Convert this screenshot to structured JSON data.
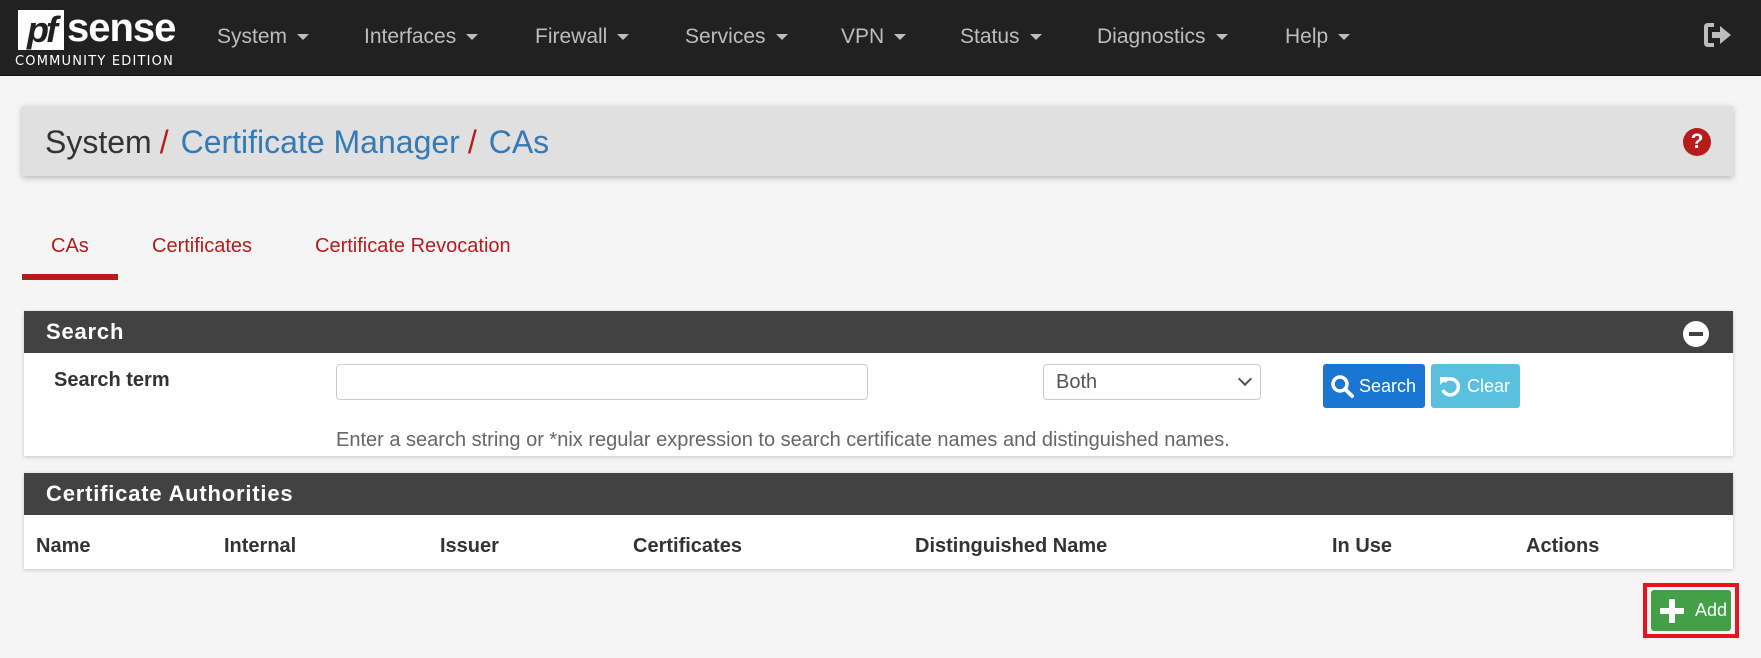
{
  "brand": {
    "logo_pf": "pf",
    "logo_sense": "sense",
    "edition": "COMMUNITY EDITION"
  },
  "nav": {
    "items": [
      {
        "label": "System"
      },
      {
        "label": "Interfaces"
      },
      {
        "label": "Firewall"
      },
      {
        "label": "Services"
      },
      {
        "label": "VPN"
      },
      {
        "label": "Status"
      },
      {
        "label": "Diagnostics"
      },
      {
        "label": "Help"
      }
    ],
    "logout_icon": "sign-out-icon"
  },
  "breadcrumb": {
    "root": "System",
    "separator": "/",
    "parent": "Certificate Manager",
    "current": "CAs",
    "help_icon": "?"
  },
  "tabs": [
    {
      "label": "CAs",
      "active": true
    },
    {
      "label": "Certificates",
      "active": false
    },
    {
      "label": "Certificate Revocation",
      "active": false
    }
  ],
  "search": {
    "title": "Search",
    "term_label": "Search term",
    "term_value": "",
    "term_placeholder": "",
    "where_selected": "Both",
    "search_button": "Search",
    "clear_button": "Clear",
    "hint": "Enter a search string or *nix regular expression to search certificate names and distinguished names."
  },
  "ca_table": {
    "title": "Certificate Authorities",
    "columns": [
      "Name",
      "Internal",
      "Issuer",
      "Certificates",
      "Distinguished Name",
      "In Use",
      "Actions"
    ],
    "rows": []
  },
  "actions": {
    "add_button": "Add"
  },
  "colors": {
    "navbar": "#212121",
    "accent_red": "#b71c1c",
    "link_blue": "#337ab7",
    "panel_header": "#424242",
    "search_button": "#1976d2",
    "clear_button": "#5bc0de",
    "add_button": "#43a047",
    "highlight_border": "#e6141e"
  }
}
